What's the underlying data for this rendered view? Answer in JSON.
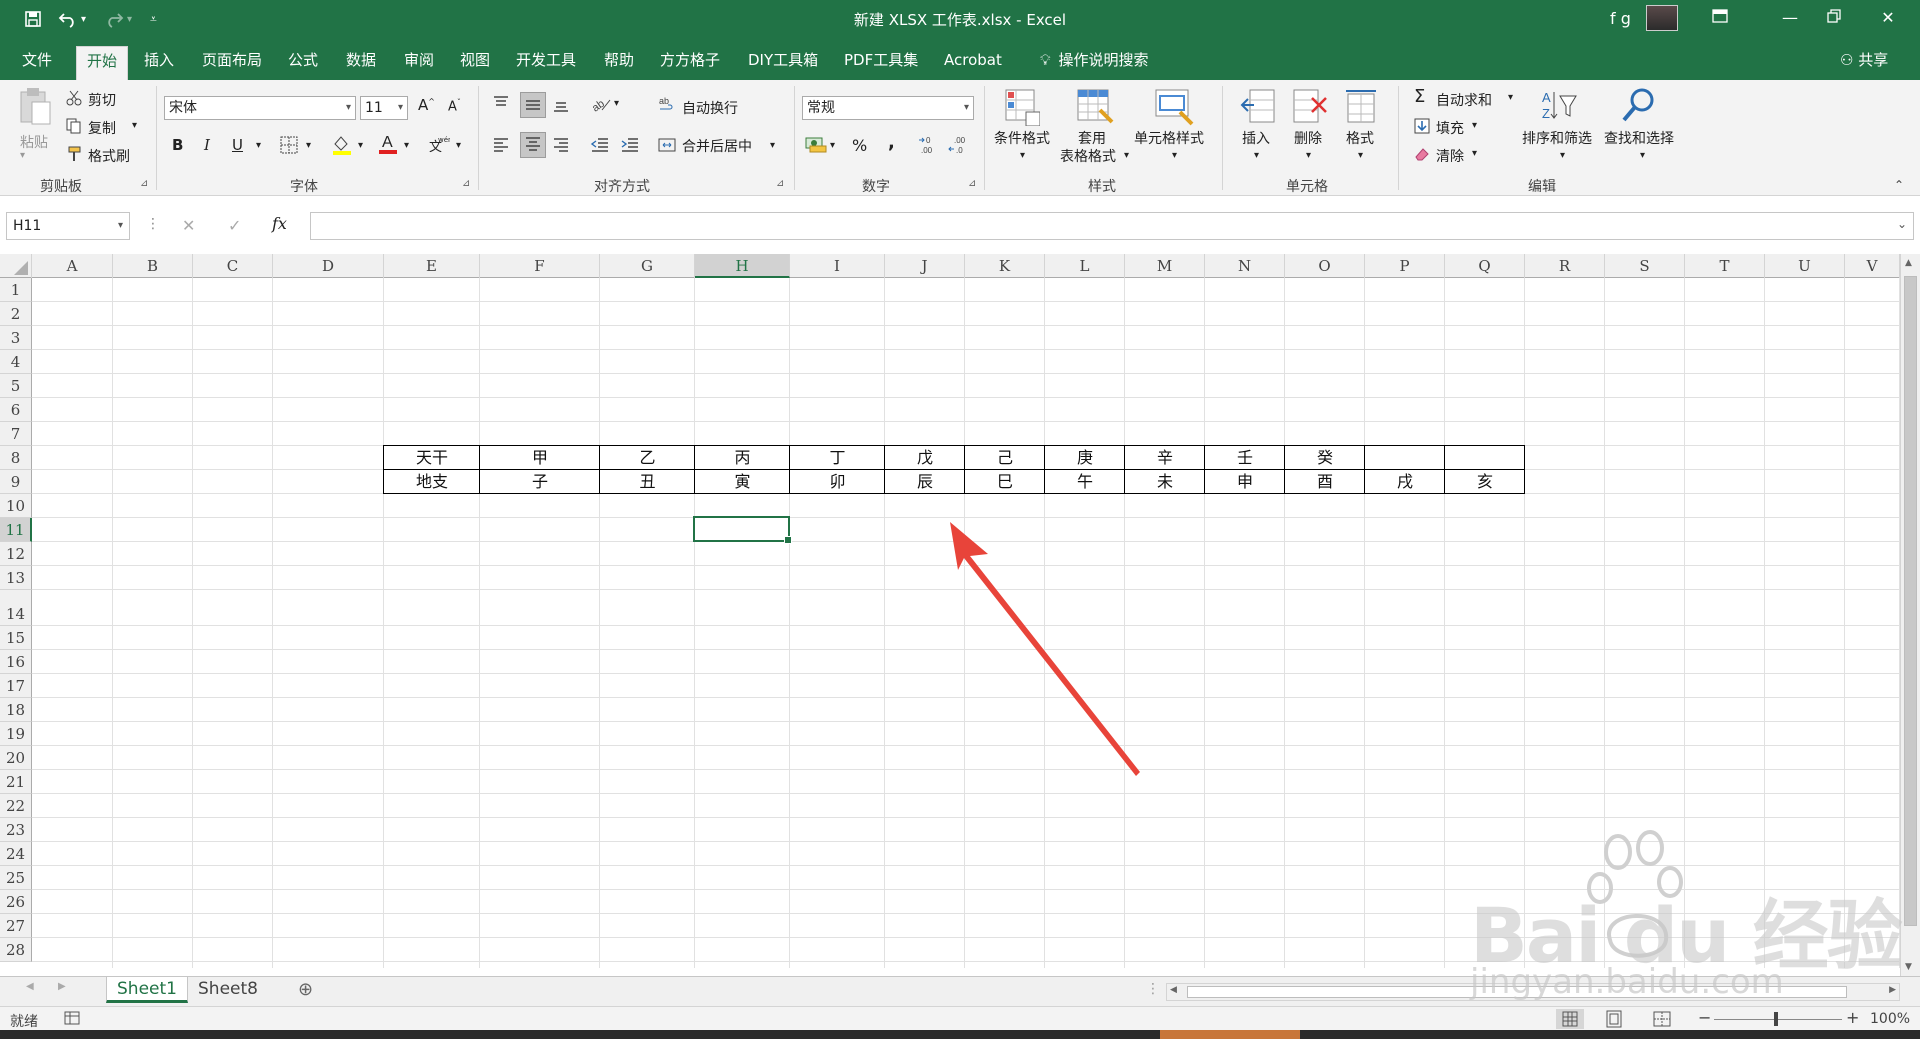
{
  "titlebar": {
    "title": "新建 XLSX 工作表.xlsx  -  Excel",
    "user": "f g"
  },
  "ribbon_tabs": [
    {
      "label": "文件"
    },
    {
      "label": "开始",
      "active": true
    },
    {
      "label": "插入"
    },
    {
      "label": "页面布局"
    },
    {
      "label": "公式"
    },
    {
      "label": "数据"
    },
    {
      "label": "审阅"
    },
    {
      "label": "视图"
    },
    {
      "label": "开发工具"
    },
    {
      "label": "帮助"
    },
    {
      "label": "方方格子"
    },
    {
      "label": "DIY工具箱"
    },
    {
      "label": "PDF工具集"
    },
    {
      "label": "Acrobat"
    },
    {
      "label": "操作说明搜索"
    }
  ],
  "share_label": "共享",
  "ribbon": {
    "clipboard": {
      "paste": "粘贴",
      "cut": "剪切",
      "copy": "复制",
      "format_painter": "格式刷",
      "group": "剪贴板"
    },
    "font": {
      "font_name": "宋体",
      "font_size": "11",
      "bold": "B",
      "italic": "I",
      "underline": "U",
      "group": "字体"
    },
    "alignment": {
      "wrap": "自动换行",
      "merge": "合并后居中",
      "group": "对齐方式"
    },
    "number": {
      "format": "常规",
      "percent": "%",
      "comma": ",",
      "group": "数字"
    },
    "styles": {
      "conditional": "条件格式",
      "table_format_1": "套用",
      "table_format_2": "表格格式",
      "cell_style": "单元格样式",
      "group": "样式"
    },
    "cells": {
      "insert": "插入",
      "delete": "删除",
      "format": "格式",
      "group": "单元格"
    },
    "editing": {
      "autosum": "自动求和",
      "fill": "填充",
      "clear": "清除",
      "sort_filter": "排序和筛选",
      "find_select": "查找和选择",
      "group": "编辑"
    }
  },
  "formula_bar": {
    "name_box": "H11",
    "cancel": "✕",
    "enter": "✓",
    "fx": "fx",
    "value": ""
  },
  "columns": [
    "A",
    "B",
    "C",
    "D",
    "E",
    "F",
    "G",
    "H",
    "I",
    "J",
    "K",
    "L",
    "M",
    "N",
    "O",
    "P",
    "Q",
    "R",
    "S",
    "T",
    "U",
    "V"
  ],
  "rows": [
    "1",
    "2",
    "3",
    "4",
    "5",
    "6",
    "7",
    "8",
    "9",
    "10",
    "11",
    "12",
    "13",
    "14",
    "15",
    "16",
    "17",
    "18",
    "19",
    "20",
    "21",
    "22",
    "23",
    "24",
    "25",
    "26",
    "27",
    "28"
  ],
  "table": {
    "row8": [
      "天干",
      "甲",
      "乙",
      "丙",
      "丁",
      "戊",
      "己",
      "庚",
      "辛",
      "壬",
      "癸",
      "",
      ""
    ],
    "row9": [
      "地支",
      "子",
      "丑",
      "寅",
      "卯",
      "辰",
      "巳",
      "午",
      "未",
      "申",
      "酉",
      "戌",
      "亥"
    ]
  },
  "sheets": [
    {
      "name": "Sheet1",
      "active": true
    },
    {
      "name": "Sheet8",
      "active": false
    }
  ],
  "status": {
    "ready": "就绪",
    "zoom": "100%",
    "zoom_minus": "−",
    "zoom_plus": "+"
  },
  "watermark": {
    "brand": "Bai du 经验",
    "url": "jingyan.baidu.com"
  },
  "colors": {
    "accent": "#217346",
    "arrow": "#e8443a"
  }
}
